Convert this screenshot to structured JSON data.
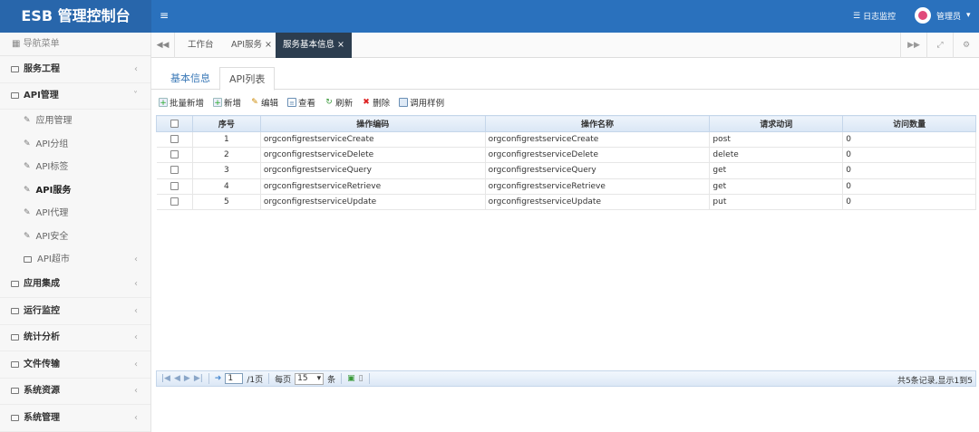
{
  "app": {
    "title": "ESB 管理控制台",
    "menu_toggle": "≡"
  },
  "header": {
    "log_monitor": "日志监控",
    "user": "管理员"
  },
  "sidebar": {
    "nav_header": "导航菜单",
    "groups": [
      {
        "label": "服务工程"
      },
      {
        "label": "API管理",
        "sub": [
          "应用管理",
          "API分组",
          "API标签",
          "API服务",
          "API代理",
          "API安全",
          "API超市"
        ]
      },
      {
        "label": "应用集成"
      },
      {
        "label": "运行监控"
      },
      {
        "label": "统计分析"
      },
      {
        "label": "文件传输"
      },
      {
        "label": "系统资源"
      },
      {
        "label": "系统管理"
      }
    ]
  },
  "tabs": [
    {
      "label": "工作台"
    },
    {
      "label": "API服务"
    },
    {
      "label": "服务基本信息"
    }
  ],
  "subtabs": [
    "基本信息",
    "API列表"
  ],
  "toolbar": [
    "批量新增",
    "新增",
    "编辑",
    "查看",
    "刷新",
    "删除",
    "调用样例"
  ],
  "grid": {
    "headers": [
      "序号",
      "操作编码",
      "操作名称",
      "请求动词",
      "访问数量"
    ],
    "rows": [
      [
        "1",
        "orgconfigrestserviceCreate",
        "orgconfigrestserviceCreate",
        "post",
        "0"
      ],
      [
        "2",
        "orgconfigrestserviceDelete",
        "orgconfigrestserviceDelete",
        "delete",
        "0"
      ],
      [
        "3",
        "orgconfigrestserviceQuery",
        "orgconfigrestserviceQuery",
        "get",
        "0"
      ],
      [
        "4",
        "orgconfigrestserviceRetrieve",
        "orgconfigrestserviceRetrieve",
        "get",
        "0"
      ],
      [
        "5",
        "orgconfigrestserviceUpdate",
        "orgconfigrestserviceUpdate",
        "put",
        "0"
      ]
    ]
  },
  "pager": {
    "page": "1",
    "total_pages": "/1页",
    "per_page_label": "每页",
    "per_page": "15",
    "per_page_unit": "条",
    "info": "共5条记录,显示1到5"
  },
  "colors": {
    "topbar": "#2a71bd",
    "active_tab": "#2c3d4f",
    "link": "#3b79b7"
  }
}
